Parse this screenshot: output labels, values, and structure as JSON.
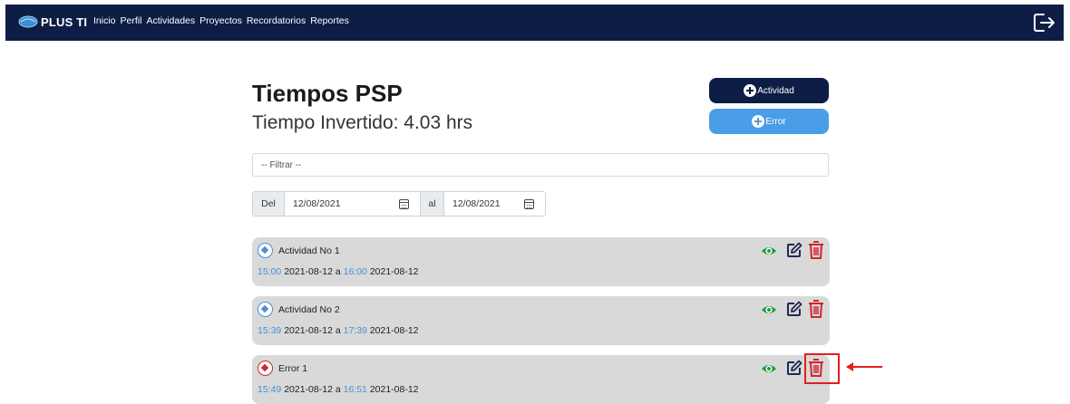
{
  "navbar": {
    "brand": "PLUS TI",
    "links": [
      "Inicio",
      "Perfil",
      "Actividades",
      "Proyectos",
      "Recordatorios",
      "Reportes"
    ],
    "logout_icon": "logout-icon"
  },
  "header": {
    "title": "Tiempos PSP",
    "time_invested": "Tiempo Invertido: 4.03 hrs",
    "add_activity_label": "Actividad",
    "add_error_label": "Error"
  },
  "filter": {
    "placeholder": "-- Filtrar --"
  },
  "date_range": {
    "from_label": "Del",
    "from_value": "12/08/2021",
    "to_label": "al",
    "to_value": "12/08/2021"
  },
  "items": [
    {
      "type": "activity",
      "title": "Actividad No 1",
      "start_time": "15:00",
      "start_date": "2021-08-12",
      "sep": "a",
      "end_time": "16:00",
      "end_date": "2021-08-12"
    },
    {
      "type": "activity",
      "title": "Actividad No 2",
      "start_time": "15:39",
      "start_date": "2021-08-12",
      "sep": "a",
      "end_time": "17:39",
      "end_date": "2021-08-12"
    },
    {
      "type": "error",
      "title": "Error 1",
      "start_time": "15:49",
      "start_date": "2021-08-12",
      "sep": "a",
      "end_time": "16:51",
      "end_date": "2021-08-12"
    }
  ],
  "colors": {
    "navbar": "#0d1d45",
    "primary_button": "#0d1d45",
    "secondary_button": "#4a9ee8",
    "card": "#d9d9d9",
    "view_icon": "#1e9a3c",
    "delete_icon": "#d0252c",
    "highlight": "#e02020"
  }
}
